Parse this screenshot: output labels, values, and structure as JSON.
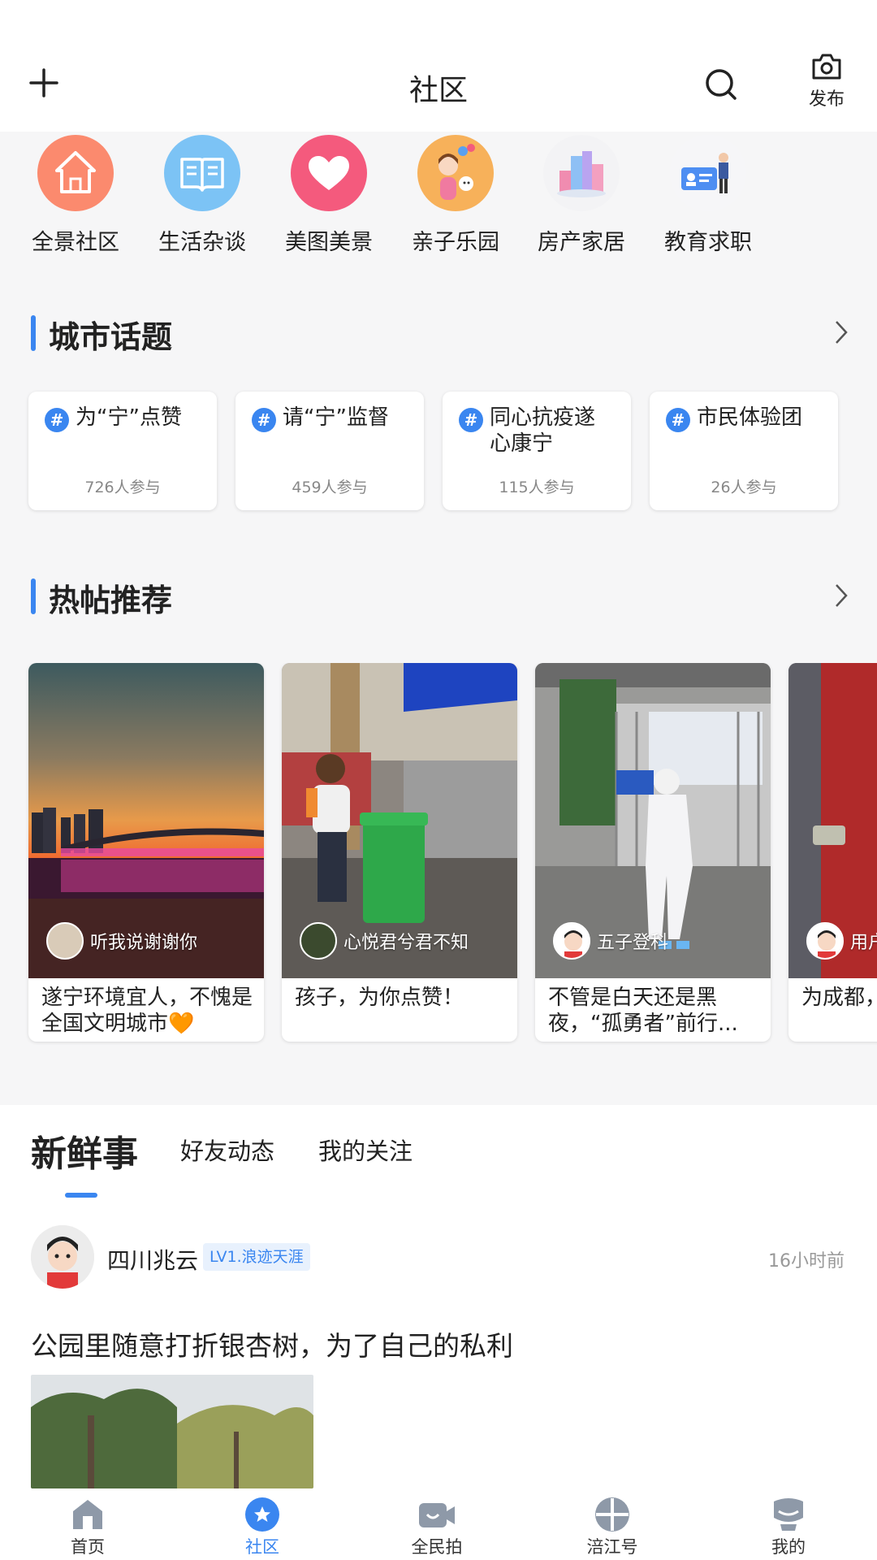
{
  "header": {
    "title": "社区",
    "post_label": "发布"
  },
  "categories": [
    {
      "label": "全景社区",
      "icon": "house-icon"
    },
    {
      "label": "生活杂谈",
      "icon": "book-icon"
    },
    {
      "label": "美图美景",
      "icon": "heart-icon"
    },
    {
      "label": "亲子乐园",
      "icon": "family-icon"
    },
    {
      "label": "房产家居",
      "icon": "buildings-icon"
    },
    {
      "label": "教育求职",
      "icon": "id-card-icon"
    }
  ],
  "topics_section": {
    "title": "城市话题"
  },
  "topics": [
    {
      "name": "为“宁”点赞",
      "count": "726人参与"
    },
    {
      "name": "请“宁”监督",
      "count": "459人参与"
    },
    {
      "name": "同心抗疫遂心康宁",
      "count": "115人参与"
    },
    {
      "name": "市民体验团",
      "count": "26人参与"
    }
  ],
  "hot_section": {
    "title": "热帖推荐"
  },
  "hot_posts": [
    {
      "author": "听我说谢谢你",
      "title": "遂宁环境宜人，不愧是全国文明城市🧡"
    },
    {
      "author": "心悦君兮君不知",
      "title": "孩子，为你点赞！"
    },
    {
      "author": "五子登科",
      "title": "不管是白天还是黑夜，“孤勇者”前行..."
    },
    {
      "author": "用户",
      "title": "为成都，可以这样"
    }
  ],
  "feed": {
    "tabs": [
      "新鲜事",
      "好友动态",
      "我的关注"
    ],
    "post": {
      "author": "四川兆云",
      "badge": "LV1.浪迹天涯",
      "time": "16小时前",
      "text": "公园里随意打折银杏树，为了自己的私利"
    }
  },
  "nav": [
    {
      "label": "首页",
      "icon": "home-icon"
    },
    {
      "label": "社区",
      "icon": "star-icon",
      "active": true
    },
    {
      "label": "全民拍",
      "icon": "camera-video-icon"
    },
    {
      "label": "涪江号",
      "icon": "compass-icon"
    },
    {
      "label": "我的",
      "icon": "profile-icon"
    }
  ],
  "colors": {
    "accent": "#3a86f0",
    "background": "#f6f6f7"
  }
}
